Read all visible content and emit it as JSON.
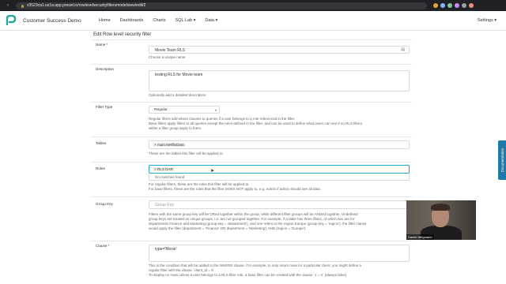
{
  "browser": {
    "url": "c0523ca1.us1a.app.preset.io/rowlevelsecurityfiltersmodelview/edit/2"
  },
  "app": {
    "name": "Customer Success Demo",
    "menu": [
      "Home",
      "Dashboards",
      "Charts",
      "SQL Lab ▾",
      "Data ▾"
    ],
    "settings_label": "Settings ▾"
  },
  "page": {
    "title": "Edit Row level security filter"
  },
  "form": {
    "name": {
      "label": "Name *",
      "value": "Movie Team RLS",
      "help": "Choose a unique name"
    },
    "description": {
      "label": "Description",
      "value": "testing RLS for Movie team",
      "help": "Optionally add a detailed description"
    },
    "filter_type": {
      "label": "Filter Type",
      "value": "Regular",
      "help1": "Regular filters add where clauses to queries if a user belongs to a role referenced in the filter.",
      "help2": "Base filters apply filters to all queries except the roles defined in the filter, and can be used to define what users can see if no RLS filters",
      "help3": "within a filter group apply to them."
    },
    "tables": {
      "label": "Tables",
      "tag": "× main.NetflixData",
      "help": "These are the tables this filter will be applied to."
    },
    "roles": {
      "label": "Roles",
      "tag": "× RLS DAR",
      "no_match": "No matches found",
      "help1": "For regular filters, these are the roles this filter will be applied to.",
      "help2": "For base filters, these are the roles that the filter DOES NOT apply to, e.g. Admin if admin should see all data."
    },
    "group_key": {
      "label": "Group Key",
      "placeholder": "Group Key",
      "help1": "Filters with the same group key will be ORed together within the group, while different filter groups will be ANDed together. Undefined",
      "help2": "group keys are treated as unique groups, i.e. are not grouped together. For example, if a table has three filters, of which two are for",
      "help3": "departments Finance and Marketing (group key = 'department'), and one refers to the region Europe (group key = 'region'), the filter clause",
      "help4": "would apply the filter (department = 'Finance' OR department = 'Marketing') AND (region = 'Europe')."
    },
    "clause": {
      "label": "Clause *",
      "value": "type='Movie'",
      "help1": "This is the condition that will be added to the WHERE clause. For example, to only return rows for a particular client, you might define a",
      "help2": "regular filter with the clause `client_id = 9`",
      "help3": "To display no rows unless a user belongs to a RLS filter role, a base filter can be created with the clause `1 = 0` (always false)."
    }
  },
  "video": {
    "participant_name": "Daniel Wegmann"
  },
  "doc_tab": {
    "label": "Documentation"
  },
  "colors": {
    "accent": "#20a7c9",
    "doc_tab": "#1f7aa8"
  }
}
